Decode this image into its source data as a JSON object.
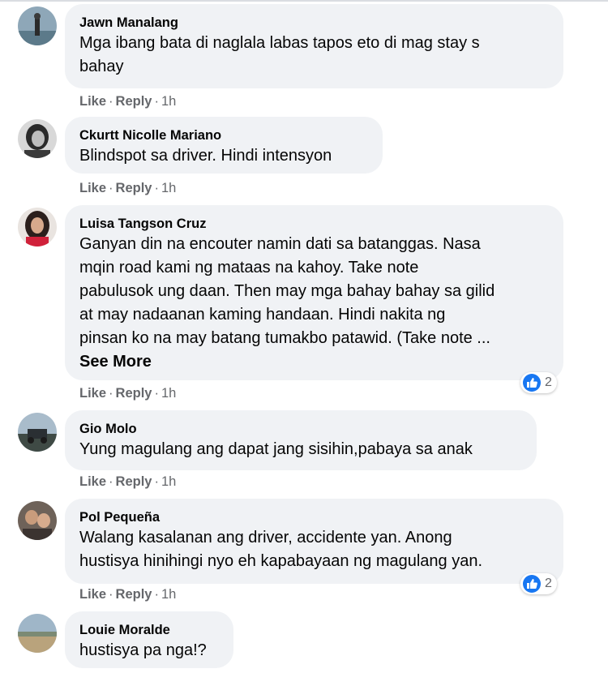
{
  "colors": {
    "bubble_bg": "#f0f2f5",
    "meta_text": "#65676b",
    "like_blue": "#1877f2"
  },
  "comments": [
    {
      "author": "Jawn Manalang",
      "lines": [
        "Mga ibang bata di naglala labas tapos eto di mag stay s",
        "bahay"
      ],
      "actions": {
        "like": "Like",
        "reply": "Reply",
        "time": "1h"
      }
    },
    {
      "author": "Ckurtt Nicolle Mariano",
      "lines": [
        "Blindspot sa driver. Hindi intensyon"
      ],
      "actions": {
        "like": "Like",
        "reply": "Reply",
        "time": "1h"
      }
    },
    {
      "author": "Luisa Tangson Cruz",
      "lines": [
        "Ganyan din na encouter namin dati sa batanggas. Nasa",
        "mqin road kami ng mataas na kahoy. Take note",
        "pabulusok ung daan. Then may mga bahay bahay sa gilid",
        "at may nadaanan kaming handaan. Hindi nakita ng",
        "pinsan ko na may batang tumakbo patawid. (Take note ..."
      ],
      "see_more": "See More",
      "reaction_count": "2",
      "reaction_icon": "like-icon",
      "actions": {
        "like": "Like",
        "reply": "Reply",
        "time": "1h"
      }
    },
    {
      "author": "Gio Molo",
      "lines": [
        "Yung magulang ang dapat jang sisihin,pabaya sa anak"
      ],
      "actions": {
        "like": "Like",
        "reply": "Reply",
        "time": "1h"
      }
    },
    {
      "author": "Pol Pequeña",
      "lines": [
        "Walang kasalanan ang driver, accidente yan. Anong",
        "hustisya hinihingi nyo eh kapabayaan ng magulang yan."
      ],
      "reaction_count": "2",
      "reaction_icon": "like-icon",
      "actions": {
        "like": "Like",
        "reply": "Reply",
        "time": "1h"
      }
    },
    {
      "author": "Louie Moralde",
      "lines": [
        "hustisya pa nga!?"
      ]
    }
  ]
}
